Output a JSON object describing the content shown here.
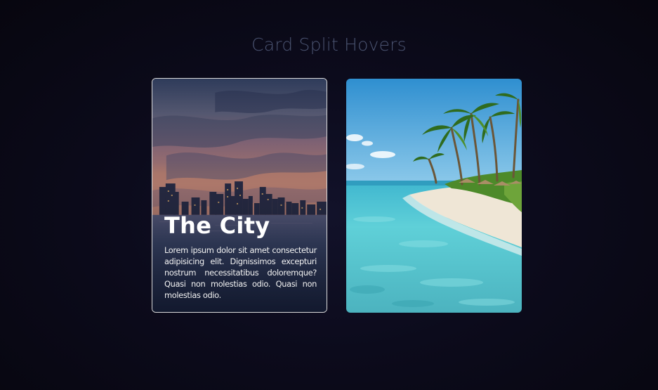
{
  "page": {
    "title": "Card Split Hovers"
  },
  "cards": [
    {
      "id": "city",
      "heading": "The City",
      "text": "Lorem ipsum dolor sit amet consectetur adipisicing elit. Dignissimos excepturi nostrum necessitatibus doloremque? Quasi non molestias odio. Quasi non molestias odio.",
      "image": "city-skyline-at-dusk"
    },
    {
      "id": "beach",
      "image": "tropical-beach-with-palm-trees"
    }
  ],
  "colors": {
    "background": "#0a0918",
    "title": "#4a5370",
    "card_border": "#dcdcdc",
    "card_text": "#ffffff"
  }
}
